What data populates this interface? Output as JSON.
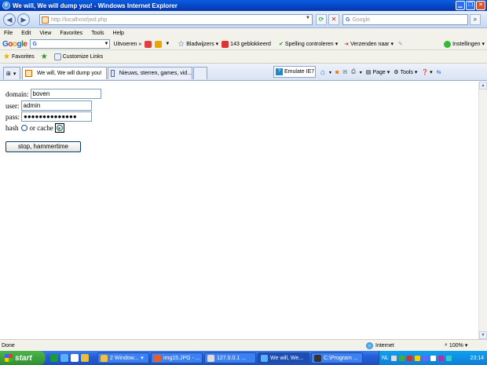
{
  "window": {
    "title": "We will, We will dump you! - Windows Internet Explorer"
  },
  "nav": {
    "url": "http://localhost/jwd.php",
    "search_placeholder": "Google"
  },
  "menu": {
    "items": [
      "File",
      "Edit",
      "View",
      "Favorites",
      "Tools",
      "Help"
    ]
  },
  "google_toolbar": {
    "logo": "Google",
    "search_prefix": "G",
    "go_label": "Uitvoeren",
    "bookmarks_label": "Bladwijzers",
    "blocked_label": "143 geblokkeerd",
    "spell_label": "Spelling controleren",
    "send_label": "Verzenden naar",
    "settings_label": "Instellingen"
  },
  "favorites_bar": {
    "favorites_label": "Favorites",
    "customize_label": "Customize Links"
  },
  "tabs": [
    {
      "label": "We will, We will dump you!",
      "active": true
    },
    {
      "label": "Nieuws, sterren, games, vid...",
      "active": false
    }
  ],
  "command_bar": {
    "emulate_label": "Emulate IE7",
    "page_label": "Page",
    "tools_label": "Tools"
  },
  "form": {
    "domain_label": "domain:",
    "domain_value": "boven",
    "user_label": "user:",
    "user_value": "admin",
    "pass_label": "pass:",
    "pass_value": "●●●●●●●●●●●●●●",
    "hash_label": "hash",
    "cache_label": "or cache",
    "submit_label": "stop, hammertime"
  },
  "status": {
    "text": "Done",
    "zone": "Internet",
    "zoom": "100%"
  },
  "taskbar": {
    "start_label": "start",
    "tasks": [
      {
        "label": "2 Window...",
        "active": false
      },
      {
        "label": "img15.JPG - ...",
        "active": false
      },
      {
        "label": "127.0.0.1 ...",
        "active": false
      },
      {
        "label": "We will, We...",
        "active": true
      },
      {
        "label": "C:\\Program ...",
        "active": false
      }
    ],
    "language": "NL",
    "clock": "23:14"
  }
}
